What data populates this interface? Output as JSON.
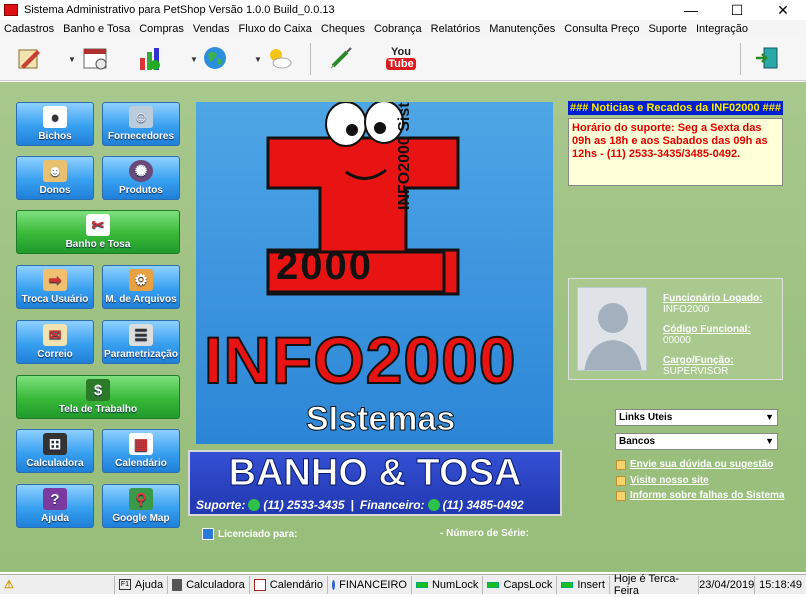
{
  "window": {
    "title": "Sistema Administrativo para PetShop Versão 1.0.0 Build_0.0.13"
  },
  "menu": [
    "Cadastros",
    "Banho e Tosa",
    "Compras",
    "Vendas",
    "Fluxo do Caixa",
    "Cheques",
    "Cobrança",
    "Relatórios",
    "Manutenções",
    "Consulta Preço",
    "Suporte",
    "Integração"
  ],
  "toolbar": {
    "youtube_label_1": "You",
    "youtube_label_2": "Tube"
  },
  "buttons": {
    "bichos": "Bichos",
    "fornecedores": "Fornecedores",
    "donos": "Donos",
    "produtos": "Produtos",
    "banho_tosa": "Banho e Tosa",
    "troca_usuario": "Troca Usuário",
    "m_arquivos": "M. de Arquivos",
    "correio": "Correio",
    "parametrizacao": "Parametrização",
    "tela_trabalho": "Tela de Trabalho",
    "calculadora": "Calculadora",
    "calendario": "Calendário",
    "ajuda": "Ajuda",
    "google_map": "Google Map"
  },
  "logo": {
    "num": "2000",
    "side": "INFO2000 Sistemas",
    "big": "INFO2000",
    "sub": "SIstemas"
  },
  "banner": {
    "title": "BANHO & TOSA",
    "suporte": "Suporte:",
    "sup_num": "(11) 2533-3435",
    "sep": "|",
    "fin": "Financeiro:",
    "fin_num": "(11) 3485-0492"
  },
  "notice": {
    "title": "### Noticias e Recados da INF02000 ###",
    "text": "Horário do suporte: Seg a Sexta das 09h as 18h e aos Sabados das 09h as 12hs - (11) 2533-3435/3485-0492."
  },
  "user": {
    "func_label": "Funcionário Logado:",
    "func_value": "INFO2000",
    "code_label": "Código Funcional:",
    "code_value": "00000",
    "role_label": "Cargo/Função:",
    "role_value": "SUPERVISOR"
  },
  "selects": {
    "links": "Links Uteis",
    "bancos": "Bancos"
  },
  "links": [
    "Envie sua dúvida ou sugestão",
    "Visite nosso site",
    "Informe sobre falhas do Sistema"
  ],
  "license": {
    "label": "Licenciado para:",
    "serial": "- Número de Série:"
  },
  "status": {
    "ajuda": "Ajuda",
    "calculadora": "Calculadora",
    "calendario": "Calendário",
    "financeiro": "FINANCEIRO",
    "numlock": "NumLock",
    "capslock": "CapsLock",
    "insert": "Insert",
    "dia": "Hoje é Terca-Feira",
    "data": "23/04/2019",
    "hora": "15:18:49"
  }
}
